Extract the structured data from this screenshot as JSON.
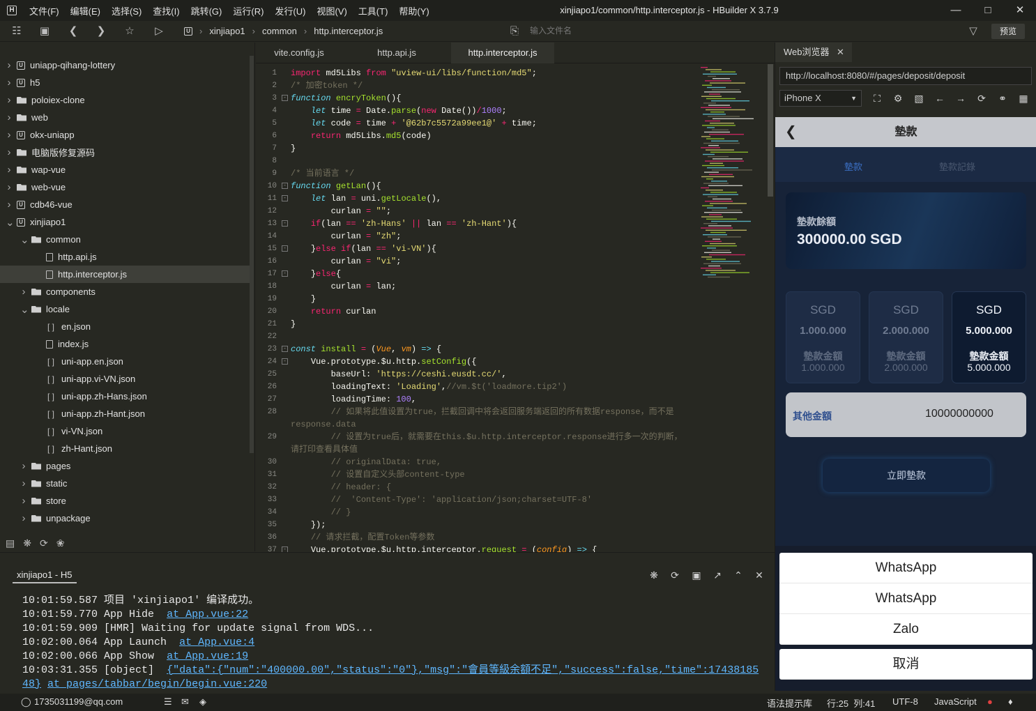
{
  "menus": [
    "文件(F)",
    "编辑(E)",
    "选择(S)",
    "查找(I)",
    "跳转(G)",
    "运行(R)",
    "发行(U)",
    "视图(V)",
    "工具(T)",
    "帮助(Y)"
  ],
  "window_title": "xinjiapo1/common/http.interceptor.js - HBuilder X 3.7.9",
  "breadcrumb": [
    "xinjiapo1",
    "common",
    "http.interceptor.js"
  ],
  "file_search_placeholder": "输入文件名",
  "preview_label": "预览",
  "tree": [
    {
      "label": "uniapp-qihang-lottery",
      "type": "project",
      "level": 0,
      "expanded": false
    },
    {
      "label": "h5",
      "type": "project",
      "level": 0,
      "expanded": false
    },
    {
      "label": "poloiex-clone",
      "type": "folder",
      "level": 0,
      "expanded": false
    },
    {
      "label": "web",
      "type": "folder",
      "level": 0,
      "expanded": false
    },
    {
      "label": "okx-uniapp",
      "type": "project",
      "level": 0,
      "expanded": false
    },
    {
      "label": "电脑版修复源码",
      "type": "folder",
      "level": 0,
      "expanded": false
    },
    {
      "label": "wap-vue",
      "type": "folder",
      "level": 0,
      "expanded": false
    },
    {
      "label": "web-vue",
      "type": "folder",
      "level": 0,
      "expanded": false
    },
    {
      "label": "cdb46-vue",
      "type": "project",
      "level": 0,
      "expanded": false
    },
    {
      "label": "xinjiapo1",
      "type": "project",
      "level": 0,
      "expanded": true
    },
    {
      "label": "common",
      "type": "folder",
      "level": 1,
      "expanded": true
    },
    {
      "label": "http.api.js",
      "type": "file",
      "level": 2
    },
    {
      "label": "http.interceptor.js",
      "type": "file",
      "level": 2,
      "selected": true
    },
    {
      "label": "components",
      "type": "folder",
      "level": 1,
      "expanded": false
    },
    {
      "label": "locale",
      "type": "folder",
      "level": 1,
      "expanded": true
    },
    {
      "label": "en.json",
      "type": "json",
      "level": 2
    },
    {
      "label": "index.js",
      "type": "file",
      "level": 2
    },
    {
      "label": "uni-app.en.json",
      "type": "json",
      "level": 2
    },
    {
      "label": "uni-app.vi-VN.json",
      "type": "json",
      "level": 2
    },
    {
      "label": "uni-app.zh-Hans.json",
      "type": "json",
      "level": 2
    },
    {
      "label": "uni-app.zh-Hant.json",
      "type": "json",
      "level": 2
    },
    {
      "label": "vi-VN.json",
      "type": "json",
      "level": 2
    },
    {
      "label": "zh-Hant.json",
      "type": "json",
      "level": 2
    },
    {
      "label": "pages",
      "type": "folder",
      "level": 1,
      "expanded": false
    },
    {
      "label": "static",
      "type": "folder",
      "level": 1,
      "expanded": false
    },
    {
      "label": "store",
      "type": "folder",
      "level": 1,
      "expanded": false
    },
    {
      "label": "unpackage",
      "type": "folder",
      "level": 1,
      "expanded": false
    }
  ],
  "editor_tabs": [
    "vite.config.js",
    "http.api.js",
    "http.interceptor.js"
  ],
  "active_tab": 2,
  "code_lines": [
    {
      "n": "1",
      "fold": false,
      "html": "<span class='k'>import</span> <span class='t'>md5Libs</span> <span class='k'>from</span> <span class='s'>\"uview-ui/libs/function/md5\"</span><span class='t'>;</span>"
    },
    {
      "n": "2",
      "fold": false,
      "html": "<span class='c'>/* 加密token */</span>"
    },
    {
      "n": "3",
      "fold": true,
      "html": "<span class='kb'>function</span> <span class='f'>encryToken</span><span class='t'>(){</span>"
    },
    {
      "n": "4",
      "fold": false,
      "html": "    <span class='kb'>let</span> <span class='t'>time</span> <span class='k'>=</span> <span class='t'>Date.</span><span class='f'>parse</span><span class='t'>(</span><span class='k'>new</span> <span class='t'>Date())</span><span class='k'>/</span><span class='n'>1000</span><span class='t'>;</span>"
    },
    {
      "n": "5",
      "fold": false,
      "html": "    <span class='kb'>let</span> <span class='t'>code</span> <span class='k'>=</span> <span class='t'>time</span> <span class='k'>+</span> <span class='s'>'@62b7c5572a99ee1@'</span> <span class='k'>+</span> <span class='t'>time;</span>"
    },
    {
      "n": "6",
      "fold": false,
      "html": "    <span class='k'>return</span> <span class='t'>md5Libs.</span><span class='f'>md5</span><span class='t'>(code)</span>"
    },
    {
      "n": "7",
      "fold": false,
      "html": "<span class='t'>}</span>"
    },
    {
      "n": "8",
      "fold": false,
      "html": ""
    },
    {
      "n": "9",
      "fold": false,
      "html": "<span class='c'>/* 当前语言 */</span>"
    },
    {
      "n": "10",
      "fold": true,
      "html": "<span class='kb'>function</span> <span class='f'>getLan</span><span class='t'>(){</span>"
    },
    {
      "n": "11",
      "fold": true,
      "html": "    <span class='kb'>let</span> <span class='t'>lan</span> <span class='k'>=</span> <span class='t'>uni.</span><span class='f'>getLocale</span><span class='t'>(),</span>"
    },
    {
      "n": "12",
      "fold": false,
      "html": "        <span class='t'>curlan</span> <span class='k'>=</span> <span class='s'>\"\"</span><span class='t'>;</span>"
    },
    {
      "n": "13",
      "fold": true,
      "html": "    <span class='k'>if</span><span class='t'>(lan</span> <span class='k'>==</span> <span class='s'>'zh-Hans'</span> <span class='k'>||</span> <span class='t'>lan</span> <span class='k'>==</span> <span class='s'>'zh-Hant'</span><span class='t'>){</span>"
    },
    {
      "n": "14",
      "fold": false,
      "html": "        <span class='t'>curlan</span> <span class='k'>=</span> <span class='s'>\"zh\"</span><span class='t'>;</span>"
    },
    {
      "n": "15",
      "fold": true,
      "html": "    <span class='t'>}</span><span class='k'>else</span> <span class='k'>if</span><span class='t'>(lan</span> <span class='k'>==</span> <span class='s'>'vi-VN'</span><span class='t'>){</span>"
    },
    {
      "n": "16",
      "fold": false,
      "html": "        <span class='t'>curlan</span> <span class='k'>=</span> <span class='s'>\"vi\"</span><span class='t'>;</span>"
    },
    {
      "n": "17",
      "fold": true,
      "html": "    <span class='t'>}</span><span class='k'>else</span><span class='t'>{</span>"
    },
    {
      "n": "18",
      "fold": false,
      "html": "        <span class='t'>curlan</span> <span class='k'>=</span> <span class='t'>lan;</span>"
    },
    {
      "n": "19",
      "fold": false,
      "html": "    <span class='t'>}</span>"
    },
    {
      "n": "20",
      "fold": false,
      "html": "    <span class='k'>return</span> <span class='t'>curlan</span>"
    },
    {
      "n": "21",
      "fold": false,
      "html": "<span class='t'>}</span>"
    },
    {
      "n": "22",
      "fold": false,
      "html": ""
    },
    {
      "n": "23",
      "fold": true,
      "html": "<span class='kb'>const</span> <span class='f'>install</span> <span class='k'>=</span> <span class='t'>(</span><span class='p'>Vue</span><span class='t'>,</span> <span class='p'>vm</span><span class='t'>)</span> <span class='kb'>=></span> <span class='t'>{</span>"
    },
    {
      "n": "24",
      "fold": true,
      "html": "    <span class='t'>Vue.prototype.$u.http.</span><span class='f'>setConfig</span><span class='t'>({</span>"
    },
    {
      "n": "25",
      "fold": false,
      "html": "        <span class='t'>baseUrl:</span> <span class='s'>'https://ceshi.eusdt.cc/'</span><span class='t'>,</span>"
    },
    {
      "n": "26",
      "fold": false,
      "html": "        <span class='t'>loadingText:</span> <span class='s'>'Loading'</span><span class='t'>,</span><span class='c'>//vm.$t('loadmore.tip2')</span>"
    },
    {
      "n": "27",
      "fold": false,
      "html": "        <span class='t'>loadingTime:</span> <span class='n'>100</span><span class='t'>,</span>"
    },
    {
      "n": "28",
      "fold": false,
      "html": "        <span class='c'>// 如果将此值设置为true，拦截回调中将会返回服务端返回的所有数据response，而不是</span>"
    },
    {
      "n": "",
      "fold": false,
      "html": "<span class='c'>response.data</span>"
    },
    {
      "n": "29",
      "fold": false,
      "html": "        <span class='c'>// 设置为true后，就需要在this.$u.http.interceptor.response进行多一次的判断，</span>"
    },
    {
      "n": "",
      "fold": false,
      "html": "<span class='c'>请打印查看具体值</span>"
    },
    {
      "n": "30",
      "fold": false,
      "html": "        <span class='c'>// originalData: true,</span>"
    },
    {
      "n": "31",
      "fold": false,
      "html": "        <span class='c'>// 设置自定义头部content-type</span>"
    },
    {
      "n": "32",
      "fold": false,
      "html": "        <span class='c'>// header: {</span>"
    },
    {
      "n": "33",
      "fold": false,
      "html": "        <span class='c'>//  'Content-Type': 'application/json;charset=UTF-8'</span>"
    },
    {
      "n": "34",
      "fold": false,
      "html": "        <span class='c'>// }</span>"
    },
    {
      "n": "35",
      "fold": false,
      "html": "    <span class='t'>});</span>"
    },
    {
      "n": "36",
      "fold": false,
      "html": "    <span class='c'>// 请求拦截，配置Token等参数</span>"
    },
    {
      "n": "37",
      "fold": true,
      "html": "    <span class='t'>Vue.prototype.$u.http.interceptor.</span><span class='f'>request</span> <span class='k'>=</span> <span class='t'>(</span><span class='p'>config</span><span class='t'>)</span> <span class='kb'>=></span> <span class='t'>{</span>"
    }
  ],
  "browser": {
    "tab_label": "Web浏览器",
    "url": "http://localhost:8080/#/pages/deposit/deposit",
    "device": "iPhone X",
    "page": {
      "title": "墊款",
      "tabs": [
        "墊款",
        "墊款記錄"
      ],
      "balance_label": "墊款餘額",
      "balance_value": "300000.00 SGD",
      "amounts": [
        {
          "currency": "SGD",
          "amount": "1.000.000",
          "label": "墊款金額",
          "value": "1.000.000",
          "active": false
        },
        {
          "currency": "SGD",
          "amount": "2.000.000",
          "label": "墊款金額",
          "value": "2.000.000",
          "active": false
        },
        {
          "currency": "SGD",
          "amount": "5.000.000",
          "label": "墊款金額",
          "value": "5.000.000",
          "active": true
        }
      ],
      "other_label": "其他金額",
      "other_value": "10000000000",
      "submit_label": "立即墊款",
      "sheet_items": [
        "WhatsApp",
        "WhatsApp",
        "Zalo"
      ],
      "cancel_label": "取消"
    }
  },
  "console": {
    "tab_label": "xinjiapo1 - H5",
    "lines": [
      {
        "time": "10:01:59.587",
        "text": "项目 'xinjiapo1' 编译成功。",
        "link": ""
      },
      {
        "time": "10:01:59.770",
        "text": "App Hide ",
        "link": "at App.vue:22"
      },
      {
        "time": "10:01:59.909",
        "text": "[HMR] Waiting for update signal from WDS...",
        "link": ""
      },
      {
        "time": "10:02:00.064",
        "text": "App Launch ",
        "link": "at App.vue:4"
      },
      {
        "time": "10:02:00.066",
        "text": "App Show ",
        "link": "at App.vue:19"
      },
      {
        "time": "10:03:31.355",
        "text": "[object] ",
        "link": "{\"data\":{\"num\":\"400000.00\",\"status\":\"0\"},\"msg\":\"會員等級余額不足\",\"success\":false,\"time\":17438185"
      },
      {
        "time": "",
        "text": "48}",
        "link": "at pages/tabbar/begin/begin.vue:220",
        "cont": true
      }
    ]
  },
  "status": {
    "account": "1735031199@qq.com",
    "syntax": "语法提示库",
    "position": "行:25  列:41",
    "encoding": "UTF-8",
    "language": "JavaScript"
  }
}
